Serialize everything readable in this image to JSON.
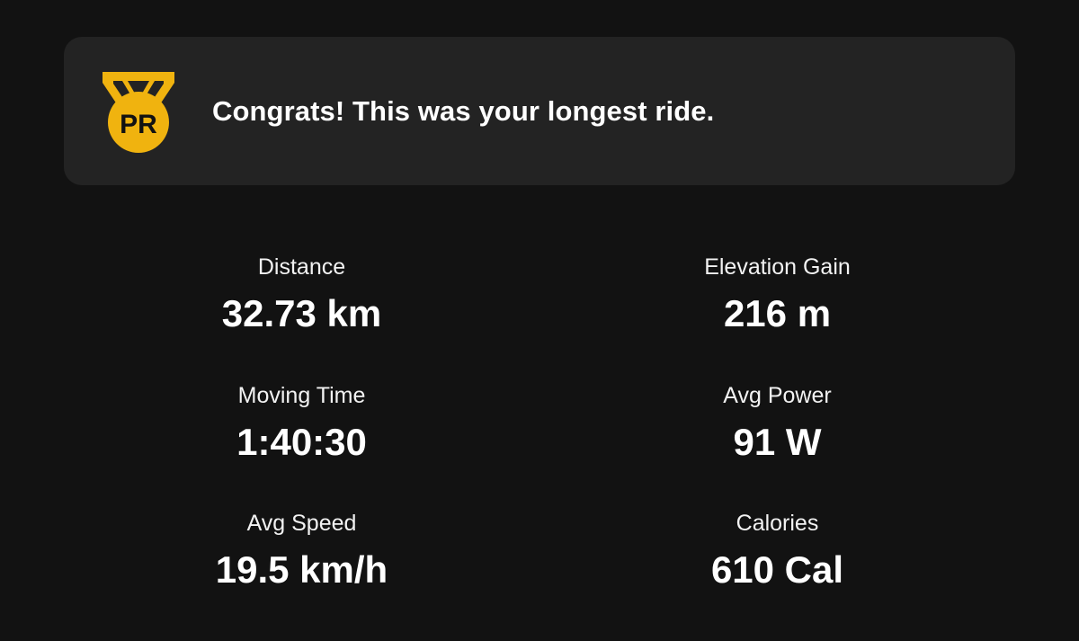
{
  "banner": {
    "badge_text": "PR",
    "message": "Congrats! This was your longest ride.",
    "badge_color": "#F0B30F",
    "badge_icon": "pr-medal-icon"
  },
  "stats": {
    "distance": {
      "label": "Distance",
      "value": "32.73 km"
    },
    "elevation_gain": {
      "label": "Elevation Gain",
      "value": "216 m"
    },
    "moving_time": {
      "label": "Moving Time",
      "value": "1:40:30"
    },
    "avg_power": {
      "label": "Avg Power",
      "value": "91 W"
    },
    "avg_speed": {
      "label": "Avg Speed",
      "value": "19.5 km/h"
    },
    "calories": {
      "label": "Calories",
      "value": "610 Cal"
    }
  },
  "colors": {
    "background": "#121212",
    "card": "#232323",
    "text": "#FFFFFF"
  }
}
